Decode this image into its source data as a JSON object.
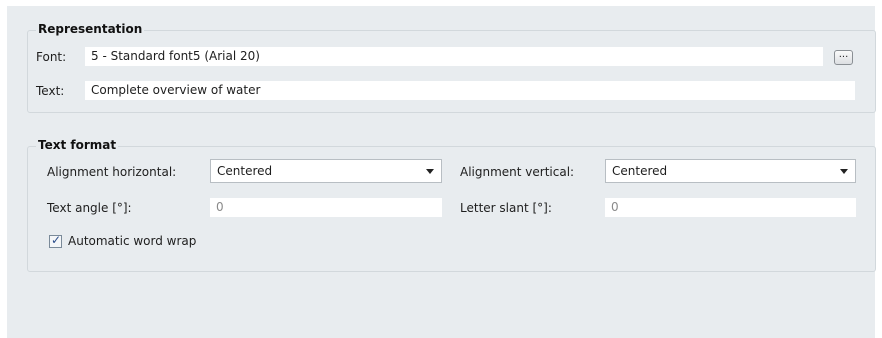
{
  "representation": {
    "title": "Representation",
    "font_label": "Font:",
    "font_value": "5 - Standard font5 (Arial 20)",
    "browse_label": "...",
    "text_label": "Text:",
    "text_value": "Complete overview of water"
  },
  "text_format": {
    "title": "Text format",
    "align_h_label": "Alignment horizontal:",
    "align_h_value": "Centered",
    "align_v_label": "Alignment vertical:",
    "align_v_value": "Centered",
    "angle_label": "Text angle [°]:",
    "angle_value": "0",
    "slant_label": "Letter slant [°]:",
    "slant_value": "0",
    "word_wrap_label": "Automatic word wrap",
    "word_wrap_checked": true
  },
  "icons": {
    "combo_arrow": "chevron-down-icon",
    "checkbox_tick": "checkmark-icon"
  }
}
